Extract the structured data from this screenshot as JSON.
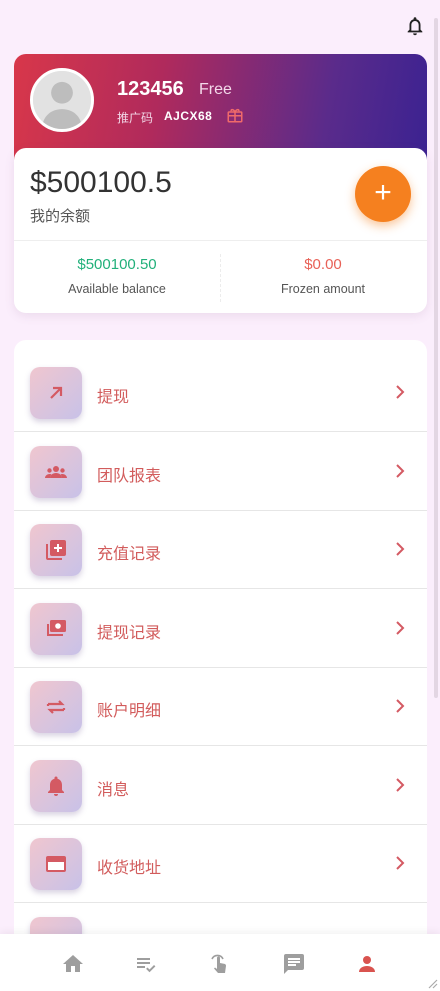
{
  "colors": {
    "accent_orange": "#f5801f",
    "available_green": "#21b07a",
    "frozen_red": "#e86157",
    "menu_text": "#d25c5c",
    "icon_red": "#d45a63",
    "nav_active": "#d9534f",
    "nav_inactive": "#9e9e9e"
  },
  "profile": {
    "username": "123456",
    "level": "Free",
    "referral_label": "推广码",
    "referral_code": "AJCX68"
  },
  "balance": {
    "amount": "$500100.5",
    "label": "我的余额",
    "available_value": "$500100.50",
    "available_caption": "Available balance",
    "frozen_value": "$0.00",
    "frozen_caption": "Frozen amount",
    "add_label": "+"
  },
  "menu": {
    "items": [
      {
        "label": "提现",
        "icon": "arrow-up-right-icon"
      },
      {
        "label": "团队报表",
        "icon": "group-icon"
      },
      {
        "label": "充值记录",
        "icon": "add-box-icon"
      },
      {
        "label": "提现记录",
        "icon": "money-icon"
      },
      {
        "label": "账户明细",
        "icon": "swap-icon"
      },
      {
        "label": "消息",
        "icon": "bell-icon"
      },
      {
        "label": "收货地址",
        "icon": "card-icon"
      }
    ]
  },
  "bottom_nav": [
    {
      "name": "home",
      "icon": "home-icon",
      "active": false
    },
    {
      "name": "tasks",
      "icon": "list-check-icon",
      "active": false
    },
    {
      "name": "grab",
      "icon": "touch-icon",
      "active": false
    },
    {
      "name": "messages",
      "icon": "chat-icon",
      "active": false
    },
    {
      "name": "profile",
      "icon": "person-icon",
      "active": true
    }
  ]
}
